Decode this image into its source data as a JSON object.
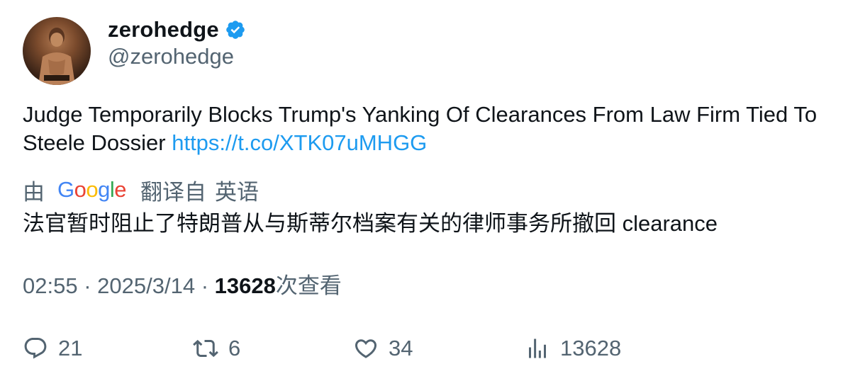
{
  "author": {
    "display_name": "zerohedge",
    "handle": "@zerohedge",
    "verified": true
  },
  "tweet": {
    "text": "Judge Temporarily Blocks Trump's Yanking Of Clearances From Law Firm Tied To Steele Dossier",
    "link": "https://t.co/XTK07uMHGG"
  },
  "translation": {
    "by_label": "由",
    "provider": "Google",
    "from_label": "翻译自",
    "language": "英语",
    "text": "法官暂时阻止了特朗普从与斯蒂尔档案有关的律师事务所撤回 clearance"
  },
  "meta": {
    "time": "02:55",
    "separator": "·",
    "date": "2025/3/14",
    "views_count": "13628",
    "views_label": "次查看"
  },
  "actions": {
    "replies": "21",
    "retweets": "6",
    "likes": "34",
    "views": "13628"
  },
  "colors": {
    "link": "#1d9bf0",
    "secondary_text": "#536471",
    "primary_text": "#0f1419",
    "verified_badge": "#1d9bf0"
  },
  "icons": [
    "verified-badge-icon",
    "reply-icon",
    "retweet-icon",
    "like-icon",
    "views-icon"
  ]
}
